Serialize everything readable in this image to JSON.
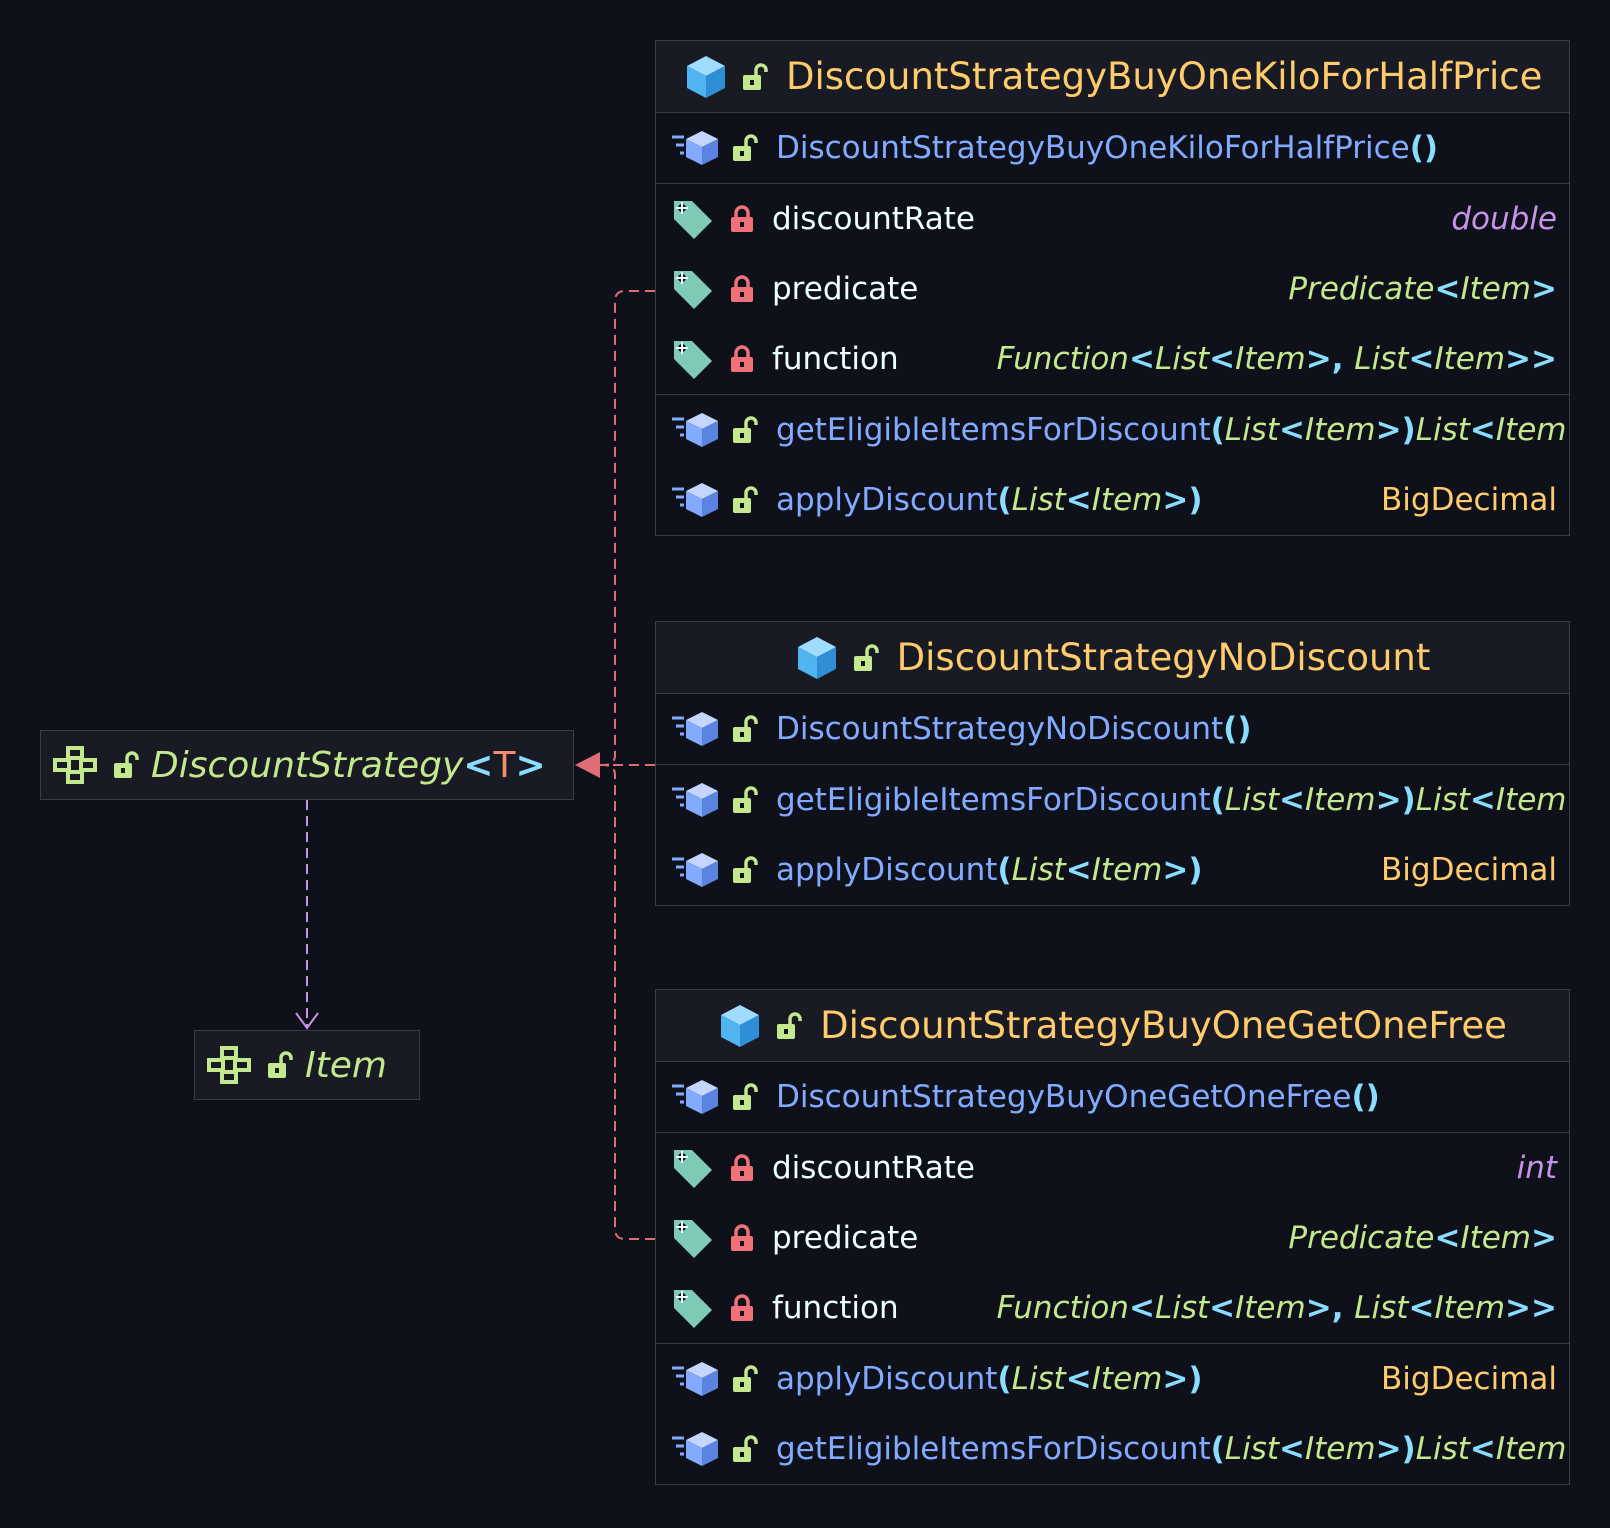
{
  "colors": {
    "background": "#0f111a",
    "box_header": "#191b24",
    "border": "#3a3d47",
    "class_name": "#ffcb6b",
    "interface_name": "#c3e88d",
    "method_name": "#82aaff",
    "field_name": "#eeffff",
    "punctuation": "#89ddff",
    "type_param": "#f78c6c",
    "primitive_type": "#c792ea",
    "implements_edge": "#e06c75",
    "dependency_edge": "#c792ea"
  },
  "interfaces": [
    {
      "name": "DiscountStrategy",
      "type_param": "T",
      "icons": [
        "interface-icon",
        "public-unlock-icon"
      ]
    },
    {
      "name": "Item",
      "icons": [
        "interface-icon",
        "public-unlock-icon"
      ]
    }
  ],
  "classes": [
    {
      "name": "DiscountStrategyBuyOneKiloForHalfPrice",
      "constructor": "DiscountStrategyBuyOneKiloForHalfPrice",
      "fields": [
        {
          "name": "discountRate",
          "type": "double",
          "kind": "prim"
        },
        {
          "name": "predicate",
          "type": "Predicate<Item>",
          "kind": "gen"
        },
        {
          "name": "function",
          "type": "Function<List<Item>, List<Item>>",
          "kind": "gen"
        }
      ],
      "methods": [
        {
          "name": "getEligibleItemsForDiscount",
          "params": "List<Item>",
          "returns": "List<Item>",
          "kind": "gen"
        },
        {
          "name": "applyDiscount",
          "params": "List<Item>",
          "returns": "BigDecimal",
          "kind": "big"
        }
      ]
    },
    {
      "name": "DiscountStrategyNoDiscount",
      "constructor": "DiscountStrategyNoDiscount",
      "fields": [],
      "methods": [
        {
          "name": "getEligibleItemsForDiscount",
          "params": "List<Item>",
          "returns": "List<Item>",
          "kind": "gen"
        },
        {
          "name": "applyDiscount",
          "params": "List<Item>",
          "returns": "BigDecimal",
          "kind": "big"
        }
      ]
    },
    {
      "name": "DiscountStrategyBuyOneGetOneFree",
      "constructor": "DiscountStrategyBuyOneGetOneFree",
      "fields": [
        {
          "name": "discountRate",
          "type": "int",
          "kind": "prim"
        },
        {
          "name": "predicate",
          "type": "Predicate<Item>",
          "kind": "gen"
        },
        {
          "name": "function",
          "type": "Function<List<Item>, List<Item>>",
          "kind": "gen"
        }
      ],
      "methods": [
        {
          "name": "applyDiscount",
          "params": "List<Item>",
          "returns": "BigDecimal",
          "kind": "big"
        },
        {
          "name": "getEligibleItemsForDiscount",
          "params": "List<Item>",
          "returns": "List<Item>",
          "kind": "gen"
        }
      ]
    }
  ],
  "edges": [
    {
      "kind": "implements",
      "from": "DiscountStrategyBuyOneKiloForHalfPrice.predicate",
      "to": "DiscountStrategy"
    },
    {
      "kind": "implements",
      "from": "DiscountStrategyNoDiscount",
      "to": "DiscountStrategy"
    },
    {
      "kind": "implements",
      "from": "DiscountStrategyBuyOneGetOneFree.predicate",
      "to": "DiscountStrategy"
    },
    {
      "kind": "dependency",
      "from": "DiscountStrategy",
      "to": "Item"
    }
  ]
}
